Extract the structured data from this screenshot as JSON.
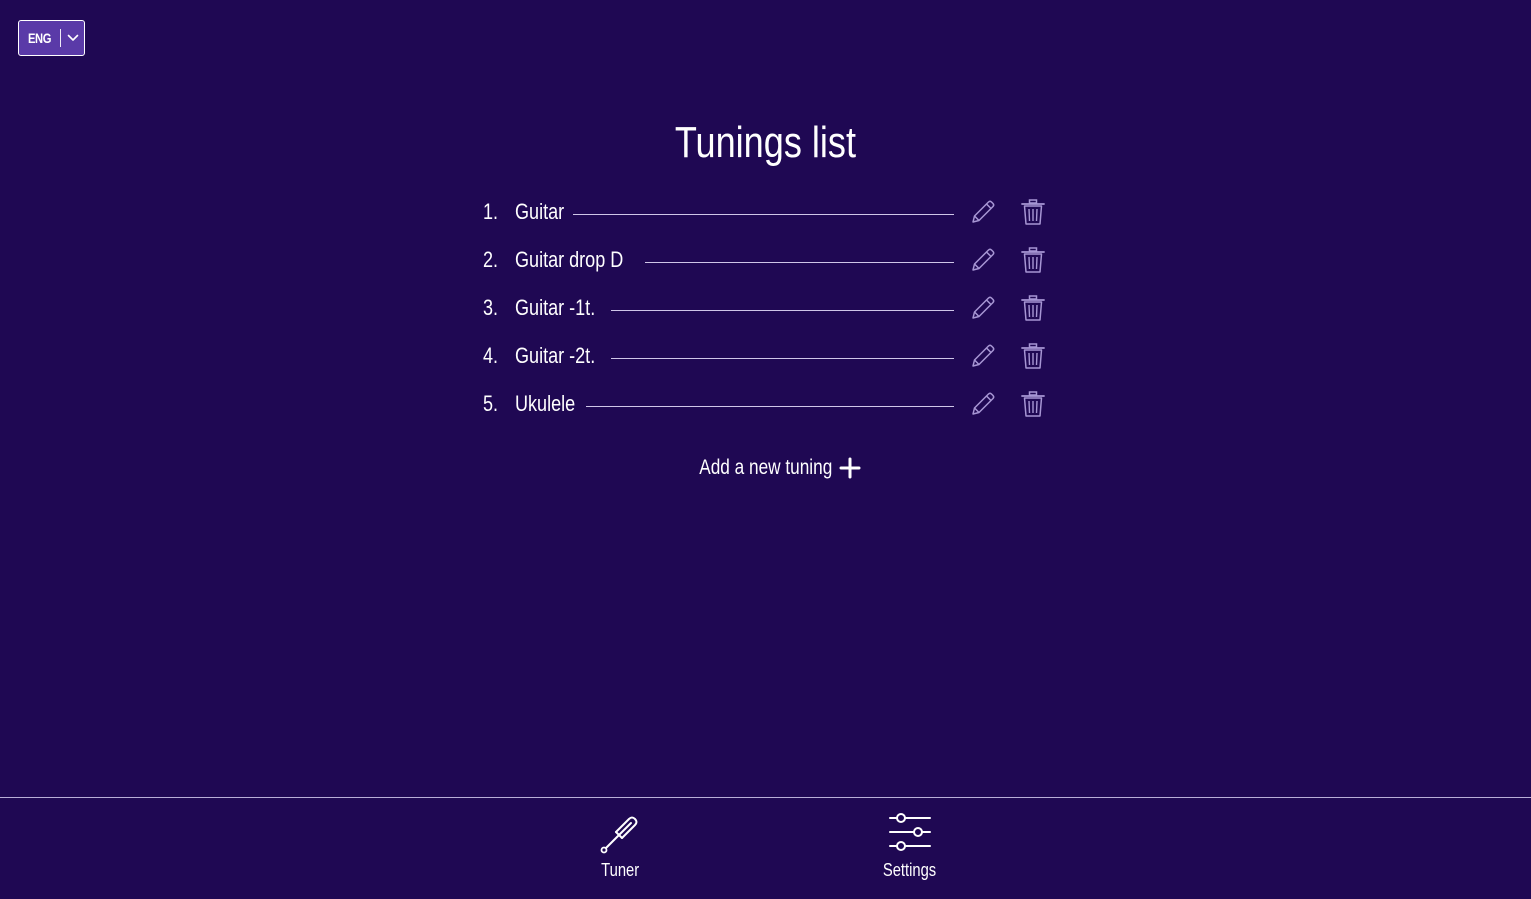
{
  "language_selector": {
    "value": "ENG"
  },
  "page": {
    "title": "Tunings list"
  },
  "tunings": [
    {
      "number": "1.",
      "name": "Guitar"
    },
    {
      "number": "2.",
      "name": "Guitar drop D"
    },
    {
      "number": "3.",
      "name": "Guitar -1t."
    },
    {
      "number": "4.",
      "name": "Guitar -2t."
    },
    {
      "number": "5.",
      "name": "Ukulele"
    }
  ],
  "add_tuning": {
    "label": "Add a new tuning",
    "icon": "plus-icon"
  },
  "bottom_nav": {
    "items": [
      {
        "label": "Tuner",
        "icon": "tuning-fork-icon"
      },
      {
        "label": "Settings",
        "icon": "sliders-icon"
      }
    ]
  },
  "colors": {
    "background": "#1f0853",
    "selector_background": "#5a3aa8",
    "text": "#ffffff",
    "icon_muted": "#a796d4",
    "divider": "#b9aed8"
  }
}
